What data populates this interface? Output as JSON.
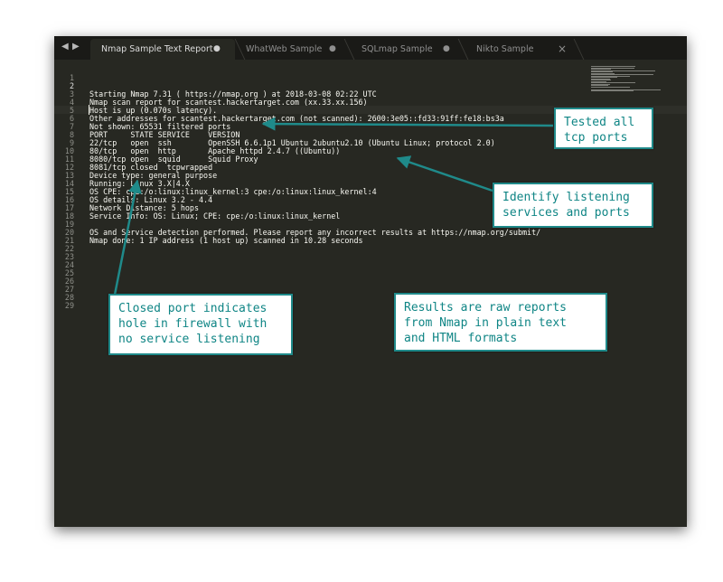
{
  "tabs": [
    {
      "label": "Nmap Sample Text Report",
      "active": true,
      "marker": "●"
    },
    {
      "label": "WhatWeb Sample",
      "active": false,
      "marker": "●"
    },
    {
      "label": "SQLmap Sample",
      "active": false,
      "marker": "●"
    },
    {
      "label": "Nikto Sample",
      "active": false,
      "marker": "×"
    }
  ],
  "nav": {
    "back": "◀",
    "forward": "▶"
  },
  "editor": {
    "current_line": 2,
    "lines": [
      "",
      "",
      "Starting Nmap 7.31 ( https://nmap.org ) at 2018-03-08 02:22 UTC",
      "Nmap scan report for scantest.hackertarget.com (xx.33.xx.156)",
      "Host is up (0.070s latency).",
      "Other addresses for scantest.hackertarget.com (not scanned): 2600:3e05::fd33:91ff:fe18:bs3a",
      "Not shown: 65531 filtered ports",
      "PORT     STATE SERVICE    VERSION",
      "22/tcp   open  ssh        OpenSSH 6.6.1p1 Ubuntu 2ubuntu2.10 (Ubuntu Linux; protocol 2.0)",
      "80/tcp   open  http       Apache httpd 2.4.7 ((Ubuntu))",
      "8080/tcp open  squid      Squid Proxy",
      "8081/tcp closed  tcpwrapped",
      "Device type: general purpose",
      "Running: Linux 3.X|4.X",
      "OS CPE: cpe:/o:linux:linux_kernel:3 cpe:/o:linux:linux_kernel:4",
      "OS details: Linux 3.2 - 4.4",
      "Network Distance: 5 hops",
      "Service Info: OS: Linux; CPE: cpe:/o:linux:linux_kernel",
      "",
      "OS and Service detection performed. Please report any incorrect results at https://nmap.org/submit/",
      "Nmap done: 1 IP address (1 host up) scanned in 10.28 seconds",
      "",
      "",
      "",
      "",
      "",
      "",
      "",
      ""
    ]
  },
  "callouts": {
    "tcp_ports": "Tested all\ntcp ports",
    "services": "Identify listening\nservices and ports",
    "closed_port": "Closed port indicates\nhole in firewall with\nno service listening",
    "results": "Results are raw reports\nfrom Nmap in plain text\nand HTML formats"
  },
  "colors": {
    "accent": "#1f8a8a",
    "background": "#272822",
    "text": "#f8f8f2"
  }
}
